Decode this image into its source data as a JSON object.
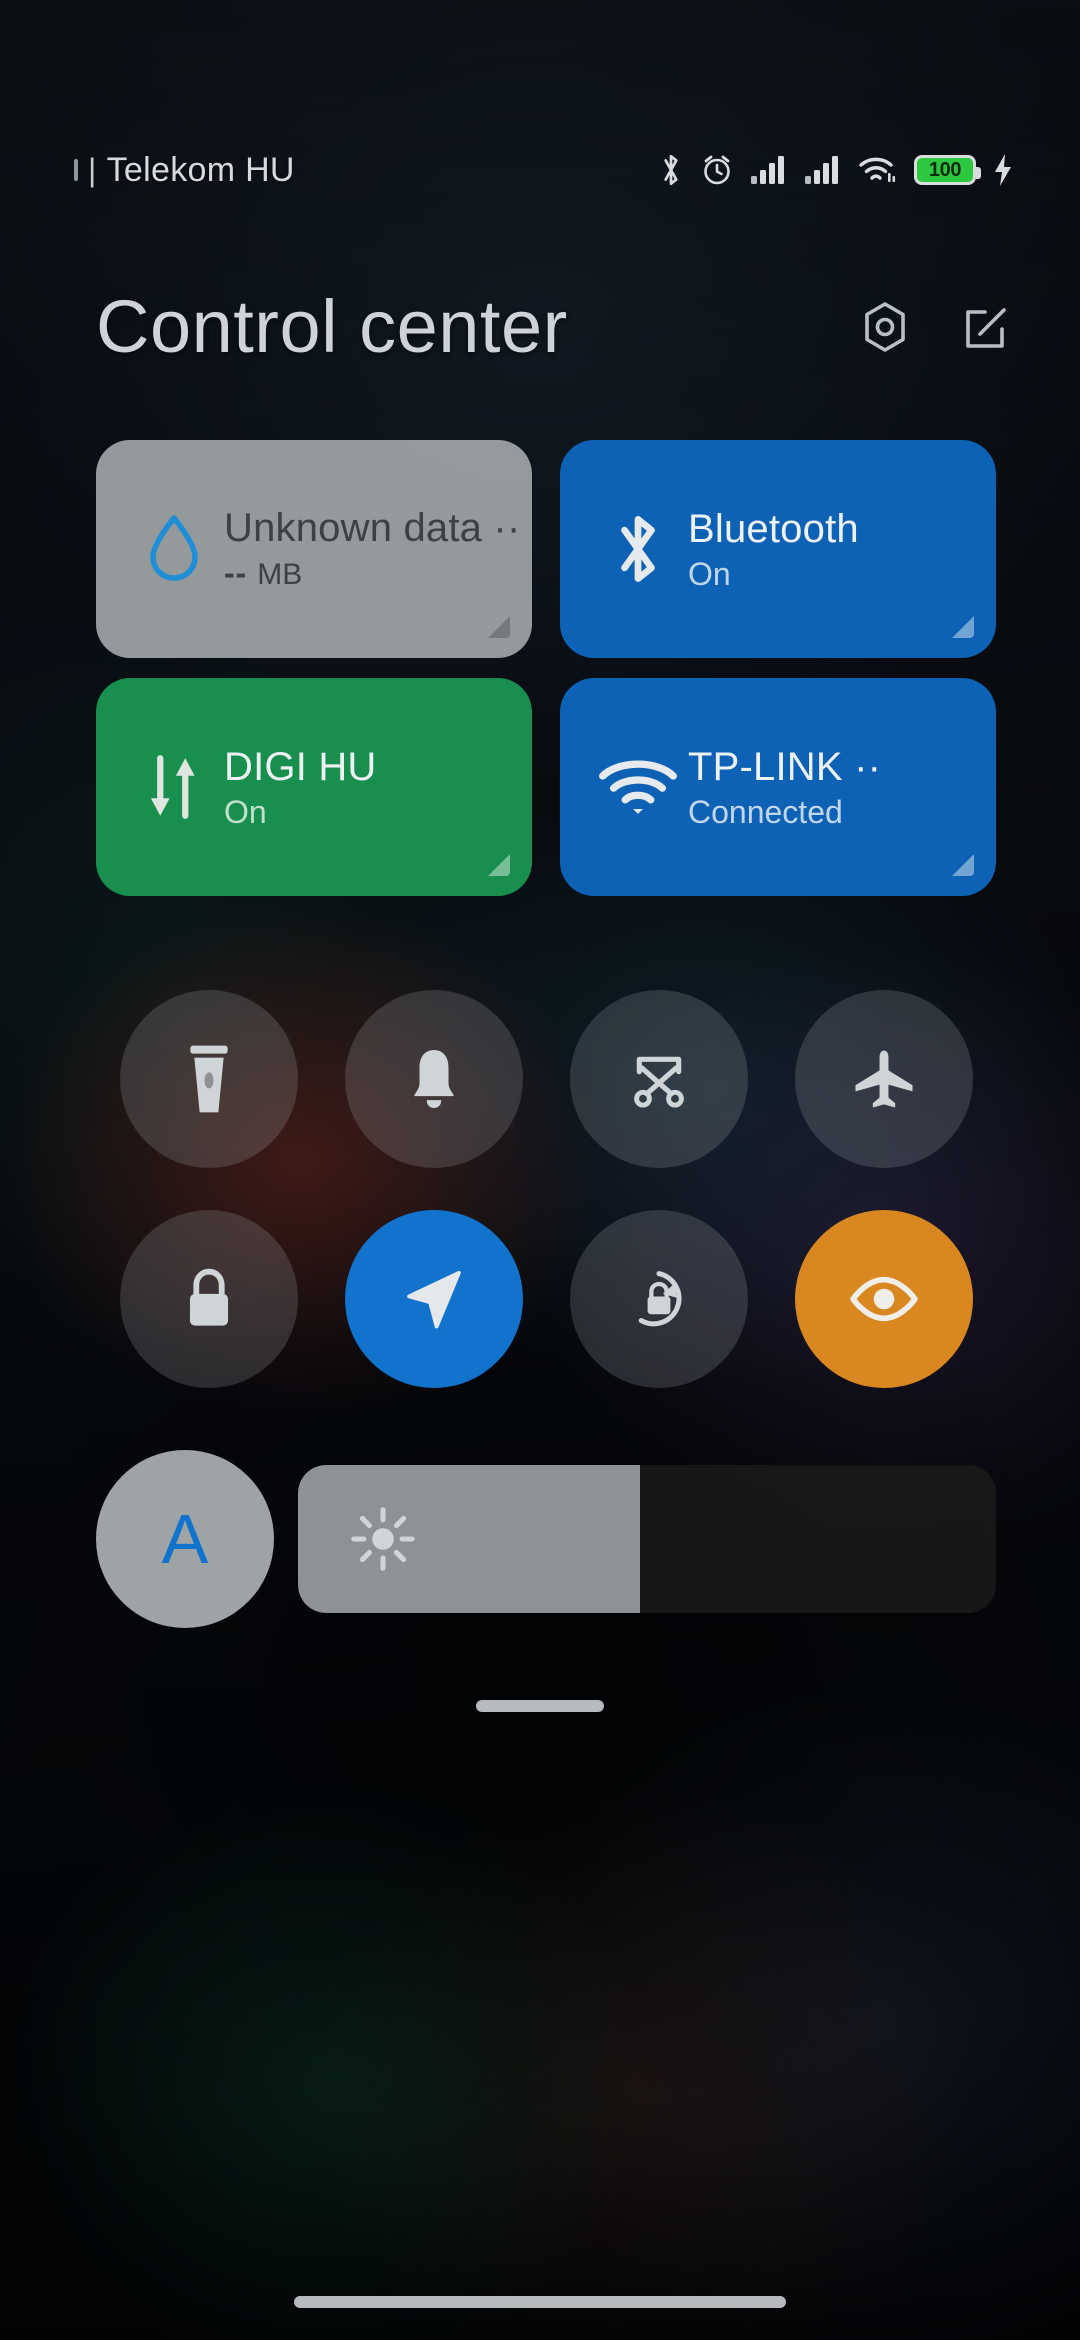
{
  "status_bar": {
    "carrier": "Telekom HU",
    "separator": "|",
    "icons": [
      "bluetooth-icon",
      "alarm-icon",
      "signal-sim1-icon",
      "signal-sim2-icon",
      "wifi-icon"
    ],
    "battery_level": "100",
    "battery_color": "#2ec840",
    "charging": true,
    "charging_icon": "lightning-bolt-icon"
  },
  "header": {
    "title": "Control center",
    "settings_icon": "hexagon-settings-icon",
    "edit_icon": "edit-pencil-icon"
  },
  "tiles": [
    {
      "id": "mobile-data-usage",
      "icon": "water-drop-icon",
      "title": "Unknown data ··",
      "subtitle": "--",
      "unit": "MB",
      "state": "off",
      "bg": "#abb0b2",
      "expandable": true
    },
    {
      "id": "bluetooth",
      "icon": "bluetooth-icon",
      "title": "Bluetooth",
      "subtitle": "On",
      "state": "on",
      "bg": "#0d62b5",
      "expandable": true
    },
    {
      "id": "mobile-data",
      "icon": "data-arrows-icon",
      "title": "DIGI HU",
      "subtitle": "On",
      "state": "on",
      "bg": "#198f4f",
      "expandable": true
    },
    {
      "id": "wifi",
      "icon": "wifi-icon",
      "title": "TP-LINK ··",
      "subtitle": "Connected",
      "state": "on",
      "bg": "#0d62b5",
      "expandable": true
    }
  ],
  "toggles": [
    {
      "id": "flashlight",
      "icon": "flashlight-icon",
      "state": "off"
    },
    {
      "id": "ringer",
      "icon": "bell-icon",
      "state": "off"
    },
    {
      "id": "screenshot",
      "icon": "screenshot-icon",
      "state": "off"
    },
    {
      "id": "airplane",
      "icon": "airplane-icon",
      "state": "off"
    },
    {
      "id": "lock-screen",
      "icon": "lock-icon",
      "state": "off"
    },
    {
      "id": "location",
      "icon": "location-arrow-icon",
      "state": "on",
      "color": "#1273cd"
    },
    {
      "id": "auto-rotate",
      "icon": "rotate-lock-icon",
      "state": "off"
    },
    {
      "id": "reading-mode",
      "icon": "eye-icon",
      "state": "on",
      "color": "#d98821"
    }
  ],
  "brightness": {
    "auto_label": "A",
    "auto_color": "#1273cd",
    "auto_state": "on",
    "slider_icon": "sun-icon",
    "slider_percent": 49
  },
  "gestures": {
    "drag_handle": "panel-drag-handle",
    "nav_bar": "home-gesture-bar"
  }
}
